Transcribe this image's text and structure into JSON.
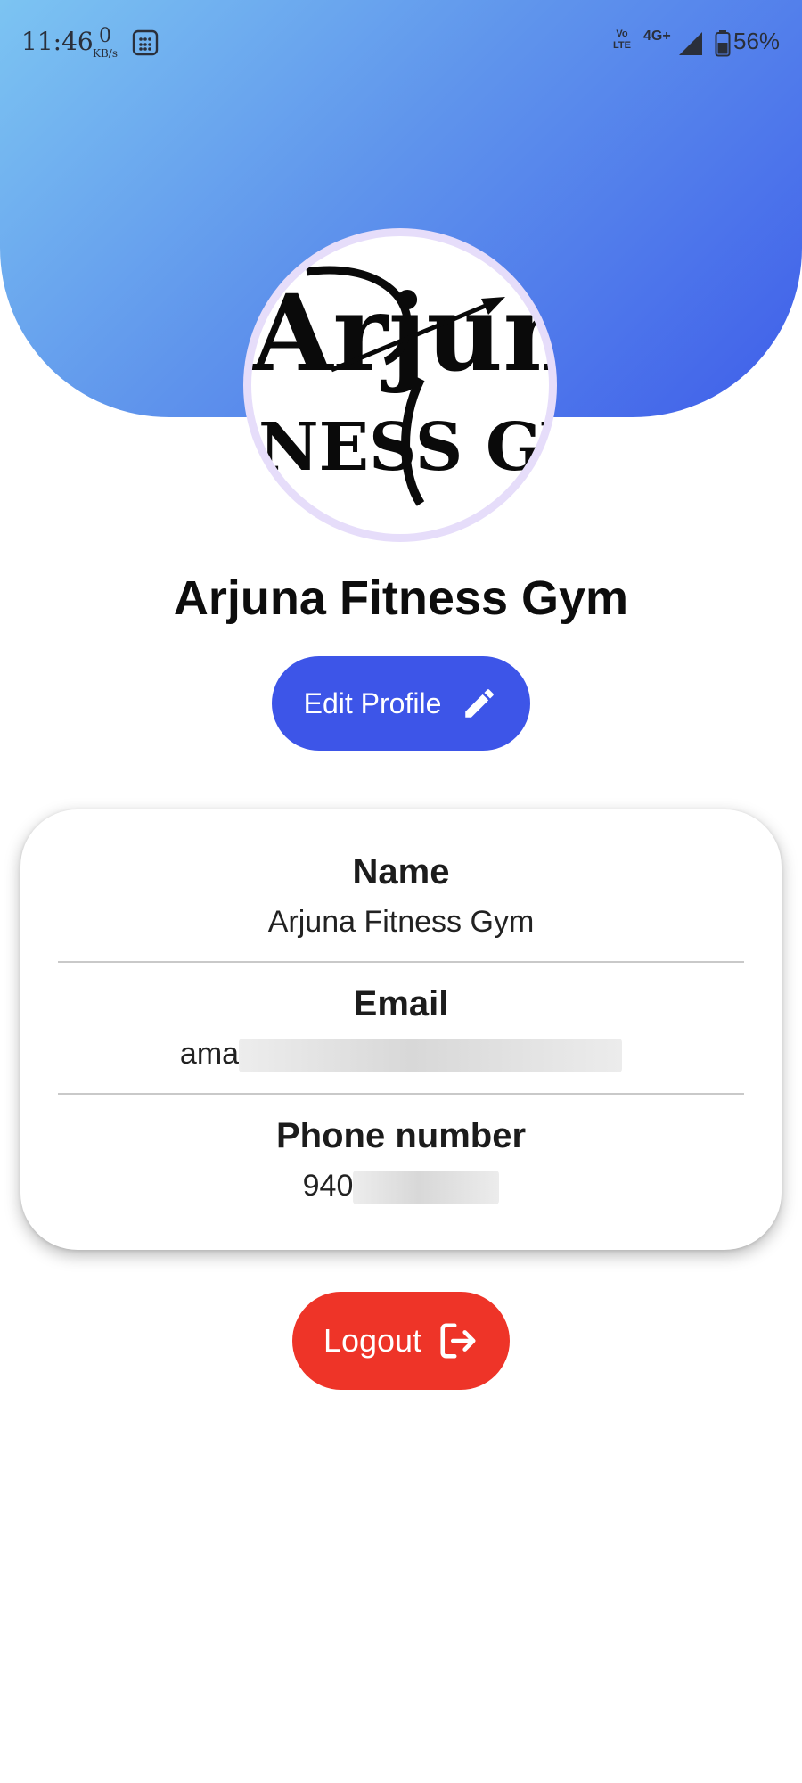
{
  "status_bar": {
    "time": "11:46",
    "net_speed_value": "0",
    "net_speed_unit": "KB/s",
    "volte_label": "Vo LTE",
    "network_type": "4G+",
    "battery_percent": "56%",
    "icons": [
      "calculator-icon",
      "signal-icon",
      "battery-icon"
    ]
  },
  "profile": {
    "name": "Arjuna Fitness Gym",
    "edit_button_label": "Edit Profile",
    "edit_icon": "pencil-icon",
    "logo_text_top": "Arjun",
    "logo_text_bottom": "NESS GY"
  },
  "details": {
    "name_label": "Name",
    "name_value": "Arjuna Fitness Gym",
    "email_label": "Email",
    "email_value_visible": "ama",
    "phone_label": "Phone number",
    "phone_value_visible": "940"
  },
  "logout": {
    "label": "Logout",
    "icon": "logout-icon"
  },
  "colors": {
    "header_gradient_start": "#7cc4f2",
    "header_gradient_end": "#3f5eea",
    "edit_button": "#3d55e8",
    "logout_button": "#ee3428",
    "avatar_ring": "#e6ddfa"
  }
}
